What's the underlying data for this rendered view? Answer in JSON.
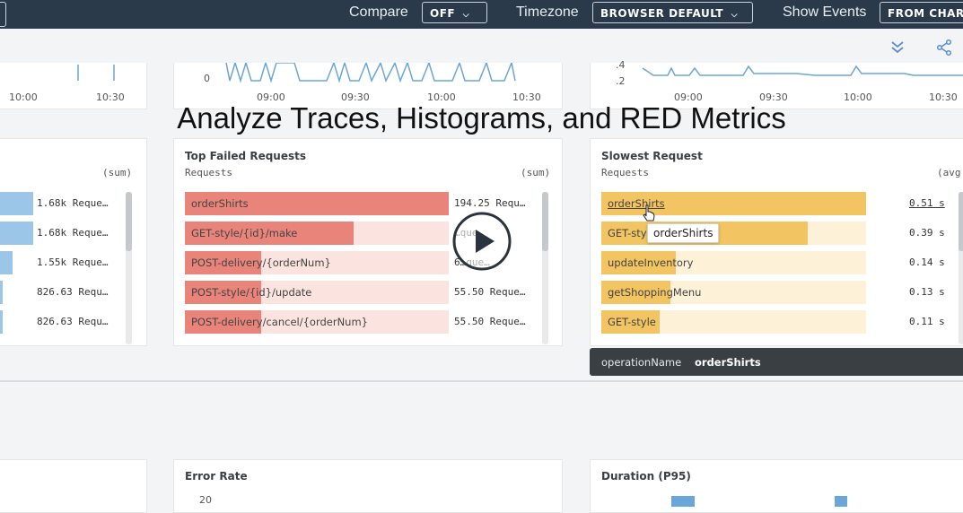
{
  "topbar": {
    "compare_label": "Compare",
    "compare_value": "OFF",
    "timezone_label": "Timezone",
    "timezone_value": "BROWSER DEFAULT",
    "show_events_label": "Show Events",
    "show_events_value": "FROM CHAR"
  },
  "top_charts": {
    "left_ticks": [
      "10:00",
      "10:30"
    ],
    "middle_ticks": [
      "09:00",
      "09:30",
      "10:00",
      "10:30"
    ],
    "middle_y": "0",
    "right_ticks": [
      "09:00",
      "09:30",
      "10:00",
      "10:30"
    ],
    "right_y": [
      ".4",
      ".2"
    ]
  },
  "video_title": "Analyze Traces, Histograms, and RED Metrics",
  "left_panel": {
    "subtitle": "(sum)",
    "rows": [
      {
        "value": "1.68k Reque…",
        "fill": 1.0
      },
      {
        "value": "1.68k Reque…",
        "fill": 1.0
      },
      {
        "value": "1.55k Reque…",
        "fill": 0.4
      },
      {
        "value": "826.63 Requ…",
        "fill": 0.1
      },
      {
        "value": "826.63 Requ…",
        "fill": 0.1
      }
    ]
  },
  "failed_panel": {
    "title": "Top Failed Requests",
    "subtitle": "Requests",
    "agg": "(sum)",
    "rows": [
      {
        "label": "orderShirts",
        "value": "194.25 Requ…",
        "fill": 1.0
      },
      {
        "label": "GET-style/{id}/make",
        "value": "…que…",
        "fill": 0.64
      },
      {
        "label": "POST-delivery/{orderNum}",
        "value": "6…que…",
        "fill": 0.29
      },
      {
        "label": "POST-style/{id}/update",
        "value": "55.50 Reque…",
        "fill": 0.29
      },
      {
        "label": "POST-delivery/cancel/{orderNum}",
        "value": "55.50 Reque…",
        "fill": 0.29
      }
    ]
  },
  "slowest_panel": {
    "title": "Slowest Request",
    "subtitle": "Requests",
    "agg": "(avg",
    "rows": [
      {
        "label": "orderShirts",
        "value": "0.51 s",
        "fill": 1.0
      },
      {
        "label": "GET-sty",
        "value": "0.39 s",
        "fill": 0.78
      },
      {
        "label": "updateInventory",
        "value": "0.14 s",
        "fill": 0.28
      },
      {
        "label": "getShoppingMenu",
        "value": "0.13 s",
        "fill": 0.26
      },
      {
        "label": "GET-style",
        "value": "0.11 s",
        "fill": 0.22
      }
    ],
    "tooltip": "orderShirts",
    "hover_key": "operationName",
    "hover_value": "orderShirts"
  },
  "bottom": {
    "error_rate_title": "Error Rate",
    "error_rate_y": "20",
    "duration_title": "Duration (P95)"
  },
  "colors": {
    "topbar": "#2b3a4a",
    "failed_fill": "#e8847a",
    "failed_bg": "#fbe3e0",
    "slow_fill": "#f2c462",
    "slow_bg": "#fdf1d8",
    "left_fill": "#9cc6e8"
  }
}
